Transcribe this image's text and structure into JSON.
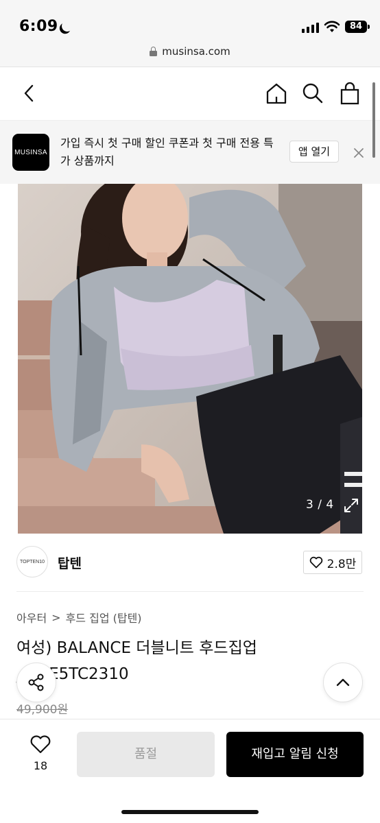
{
  "status_bar": {
    "time": "6:09",
    "battery": "84"
  },
  "browser": {
    "url": "musinsa.com"
  },
  "app_banner": {
    "logo_text": "MUSINSA",
    "message": "가입 즉시 첫 구매 할인 쿠폰과 첫 구매 전용 특가 상품까지",
    "open_app_label": "앱 열기"
  },
  "gallery": {
    "counter": "3 / 4",
    "current": 3,
    "total": 4
  },
  "brand": {
    "name": "탑텐",
    "logo_text": "TOPTEN10",
    "likes": "2.8만"
  },
  "breadcrumb": {
    "category": "아우터",
    "separator": ">",
    "subcategory": "후드 집업 (탑텐)"
  },
  "product": {
    "title": "여성) BALANCE 더블니트 후드집업_MBE5TC2310",
    "original_price": "49,900원"
  },
  "bottom_bar": {
    "wish_count": "18",
    "soldout_label": "품절",
    "restock_label": "재입고 알림 신청"
  },
  "colors": {
    "accent": "#000000",
    "disabled_bg": "#e9e9e9",
    "disabled_text": "#9a9a9a"
  }
}
